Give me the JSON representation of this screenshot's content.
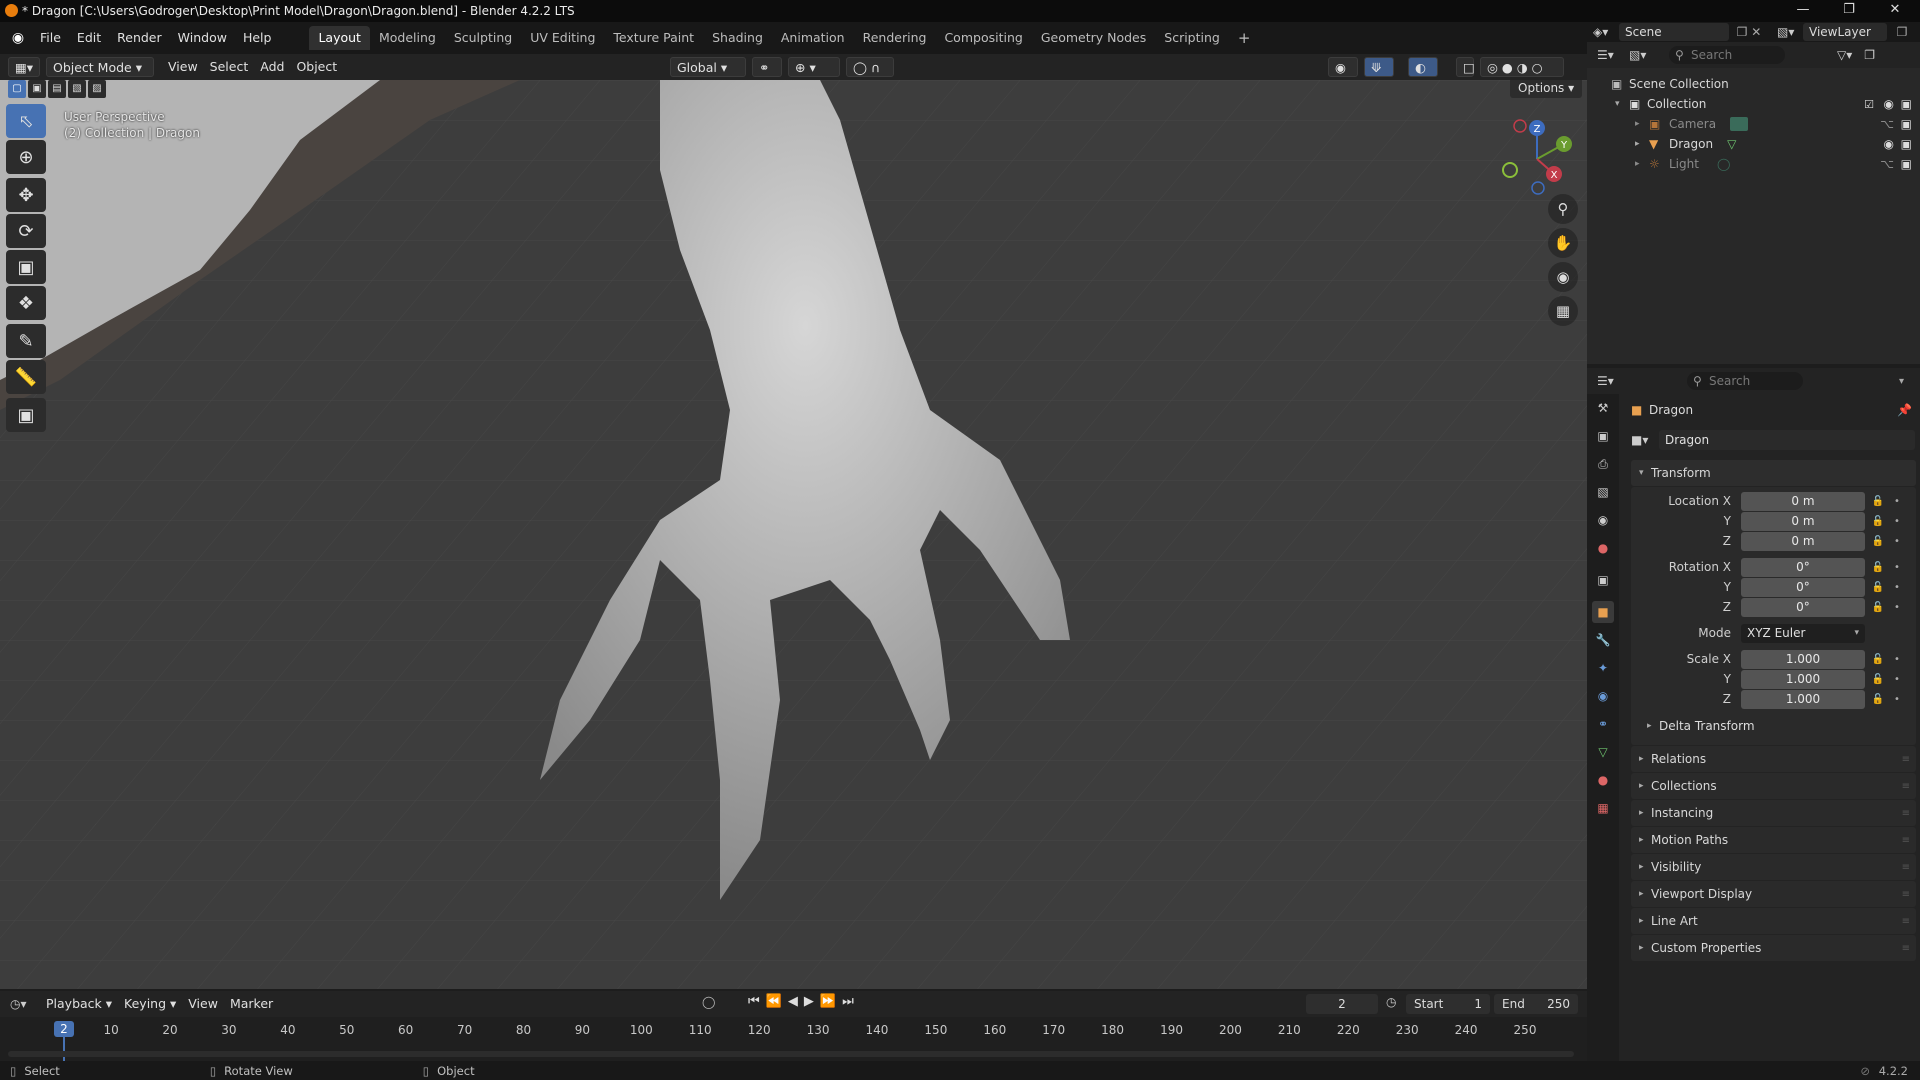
{
  "window": {
    "title": "* Dragon [C:\\Users\\Godroger\\Desktop\\Print Model\\Dragon\\Dragon.blend] - Blender 4.2.2 LTS"
  },
  "menu": [
    "File",
    "Edit",
    "Render",
    "Window",
    "Help"
  ],
  "workspaces": [
    "Layout",
    "Modeling",
    "Sculpting",
    "UV Editing",
    "Texture Paint",
    "Shading",
    "Animation",
    "Rendering",
    "Compositing",
    "Geometry Nodes",
    "Scripting"
  ],
  "active_workspace": "Layout",
  "topright": {
    "scene": "Scene",
    "view_layer": "ViewLayer"
  },
  "viewport_header": {
    "mode": "Object Mode",
    "menus": [
      "View",
      "Select",
      "Add",
      "Object"
    ],
    "orientation": "Global",
    "options": "Options"
  },
  "viewport_overlay": {
    "perspective": "User Perspective",
    "collection": "(2) Collection | Dragon"
  },
  "gizmo": {
    "x": "X",
    "y": "Y",
    "z": "Z"
  },
  "outliner": {
    "search_placeholder": "Search",
    "root": "Scene Collection",
    "collection": "Collection",
    "items": [
      {
        "name": "Camera",
        "icon": "camera-icon"
      },
      {
        "name": "Dragon",
        "icon": "mesh-icon"
      },
      {
        "name": "Light",
        "icon": "light-icon"
      }
    ]
  },
  "properties": {
    "search_placeholder": "Search",
    "object_name": "Dragon",
    "datablock_name": "Dragon",
    "transform": {
      "header": "Transform",
      "location_label": "Location X",
      "location": [
        "0 m",
        "0 m",
        "0 m"
      ],
      "rotation_label": "Rotation X",
      "rotation": [
        "0°",
        "0°",
        "0°"
      ],
      "mode_label": "Mode",
      "mode": "XYZ Euler",
      "scale_label": "Scale X",
      "scale": [
        "1.000",
        "1.000",
        "1.000"
      ],
      "axis_y": "Y",
      "axis_z": "Z"
    },
    "delta": "Delta Transform",
    "sections": [
      "Relations",
      "Collections",
      "Instancing",
      "Motion Paths",
      "Visibility",
      "Viewport Display",
      "Line Art",
      "Custom Properties"
    ]
  },
  "timeline": {
    "menus": [
      "Playback",
      "Keying",
      "View",
      "Marker"
    ],
    "current_frame": "2",
    "start_label": "Start",
    "start": "1",
    "end_label": "End",
    "end": "250",
    "ticks": [
      "10",
      "20",
      "30",
      "40",
      "50",
      "60",
      "70",
      "80",
      "90",
      "100",
      "110",
      "120",
      "130",
      "140",
      "150",
      "160",
      "170",
      "180",
      "190",
      "200",
      "210",
      "220",
      "230",
      "240",
      "250"
    ]
  },
  "statusbar": {
    "select": "Select",
    "rotate": "Rotate View",
    "object": "Object",
    "version": "4.2.2"
  },
  "colors": {
    "accent": "#4772b3",
    "orange": "#e87d0d",
    "viewport_bg": "#3d3d3d"
  }
}
